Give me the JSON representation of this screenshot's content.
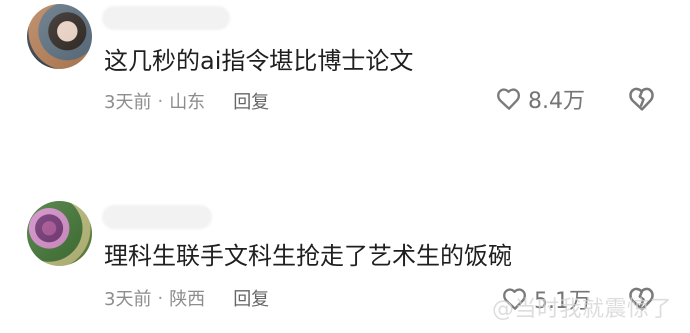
{
  "comments": [
    {
      "content": "这几秒的ai指令堪比博士论文",
      "time": "3天前",
      "location": "山东",
      "reply_label": "回复",
      "likes": "8.4万"
    },
    {
      "content": "理科生联手文科生抢走了艺术生的饭碗",
      "time": "3天前",
      "location": "陕西",
      "reply_label": "回复",
      "likes": "5.1万"
    }
  ],
  "separator": "·",
  "watermark": "@当时我就震惊了",
  "icons": [
    "heart-icon",
    "broken-heart-icon"
  ],
  "colors": {
    "text": "#1f1f1f",
    "meta": "#8d8d8d",
    "icons": "#757575"
  }
}
